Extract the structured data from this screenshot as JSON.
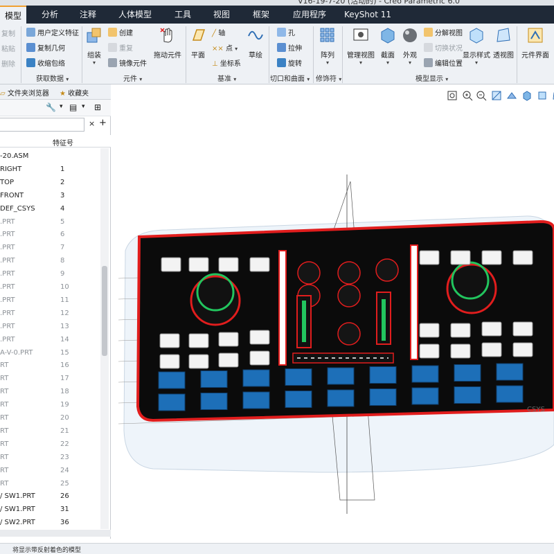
{
  "window": {
    "title": "V16-19-7-20 (活动的) - Creo Parametric 6.0"
  },
  "tabs": [
    "模型",
    "分析",
    "注释",
    "人体模型",
    "工具",
    "视图",
    "框架",
    "应用程序",
    "KeyShot 11"
  ],
  "ribbon": {
    "left_cut": [
      "复制",
      "粘贴",
      "删除"
    ],
    "get_data": {
      "items": [
        "用户定义特征",
        "复制几何",
        "收缩包络"
      ],
      "group": "获取数据"
    },
    "component": {
      "big": [
        "组装",
        "拖动元件"
      ],
      "small": [
        "创建",
        "重复",
        "镜像元件"
      ],
      "group": "元件"
    },
    "datum": {
      "big": [
        "平面",
        "草绘"
      ],
      "small": [
        "轴",
        "点",
        "坐标系"
      ],
      "group": "基准"
    },
    "cut_surface": {
      "small": [
        "孔",
        "拉伸",
        "旋转"
      ],
      "group": "切口和曲面"
    },
    "modifier": {
      "big": [
        "阵列"
      ],
      "group": "修饰符"
    },
    "model_display": {
      "big": [
        "管理视图",
        "截面",
        "外观",
        "显示样式",
        "透视图"
      ],
      "small": [
        "分解视图",
        "切换状况",
        "编辑位置"
      ],
      "group": "模型显示"
    },
    "extra": {
      "big": [
        "元件界面"
      ]
    }
  },
  "panel": {
    "tabs": [
      "文件夹浏览器",
      "收藏夹"
    ],
    "column_header": "特征号",
    "tree": [
      {
        "name": "-20.ASM",
        "no": ""
      },
      {
        "name": "RIGHT",
        "no": "1"
      },
      {
        "name": "TOP",
        "no": "2"
      },
      {
        "name": "FRONT",
        "no": "3"
      },
      {
        "name": "DEF_CSYS",
        "no": "4"
      },
      {
        "name": ".PRT",
        "no": "5"
      },
      {
        "name": ".PRT",
        "no": "6"
      },
      {
        "name": ".PRT",
        "no": "7"
      },
      {
        "name": ".PRT",
        "no": "8"
      },
      {
        "name": ".PRT",
        "no": "9"
      },
      {
        "name": ".PRT",
        "no": "10"
      },
      {
        "name": ".PRT",
        "no": "11"
      },
      {
        "name": ".PRT",
        "no": "12"
      },
      {
        "name": ".PRT",
        "no": "13"
      },
      {
        "name": ".PRT",
        "no": "14"
      },
      {
        "name": "A-V-0.PRT",
        "no": "15"
      },
      {
        "name": "RT",
        "no": "16"
      },
      {
        "name": "RT",
        "no": "17"
      },
      {
        "name": "RT",
        "no": "18"
      },
      {
        "name": "RT",
        "no": "19"
      },
      {
        "name": "RT",
        "no": "20"
      },
      {
        "name": "RT",
        "no": "21"
      },
      {
        "name": "RT",
        "no": "22"
      },
      {
        "name": "RT",
        "no": "23"
      },
      {
        "name": "RT",
        "no": "24"
      },
      {
        "name": "RT",
        "no": "25"
      },
      {
        "name": "/ SW1.PRT",
        "no": "26"
      },
      {
        "name": "/ SW1.PRT",
        "no": "31"
      },
      {
        "name": "/ SW2.PRT",
        "no": "36"
      }
    ]
  },
  "model_labels": [
    "CSYS"
  ],
  "status": "将显示带反射着色的模型",
  "colors": {
    "accent": "#f0a030",
    "tab_bg": "#1f2937",
    "ribbon_bg": "#eef1f5",
    "red": "#e11d1d",
    "green": "#22c55e",
    "blue": "#1d6fb8"
  }
}
